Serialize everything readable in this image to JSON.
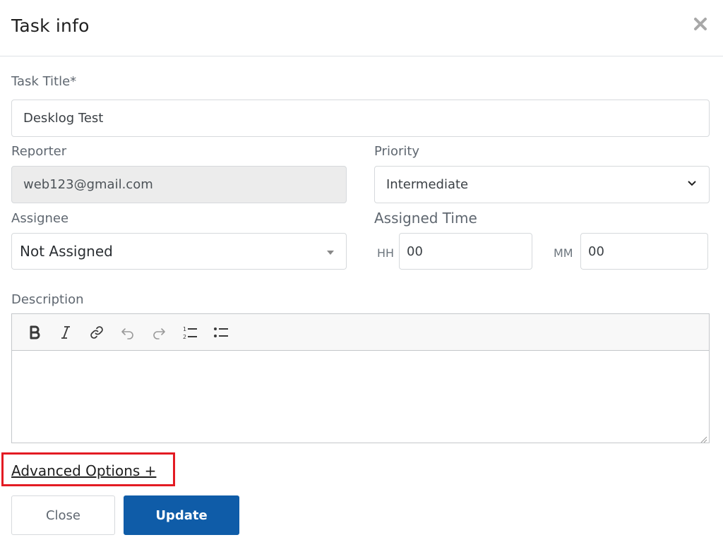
{
  "header": {
    "title": "Task info",
    "close_icon": "close-icon"
  },
  "task_title": {
    "label": "Task Title*",
    "value": "Desklog Test"
  },
  "reporter": {
    "label": "Reporter",
    "value": "web123@gmail.com"
  },
  "priority": {
    "label": "Priority",
    "selected": "Intermediate"
  },
  "assignee": {
    "label": "Assignee",
    "selected": "Not Assigned"
  },
  "assigned_time": {
    "label": "Assigned Time",
    "hours_unit": "HH",
    "hours_value": "00",
    "minutes_unit": "MM",
    "minutes_value": "00"
  },
  "description": {
    "label": "Description",
    "toolbar": [
      "bold-icon",
      "italic-icon",
      "link-icon",
      "undo-icon",
      "redo-icon",
      "ordered-list-icon",
      "bullet-list-icon"
    ],
    "content": ""
  },
  "advanced_options": "Advanced Options +",
  "buttons": {
    "close": "Close",
    "update": "Update"
  },
  "colors": {
    "primary": "#0f5ca8",
    "highlight": "#e31b23",
    "readonly_bg": "#ececec"
  }
}
